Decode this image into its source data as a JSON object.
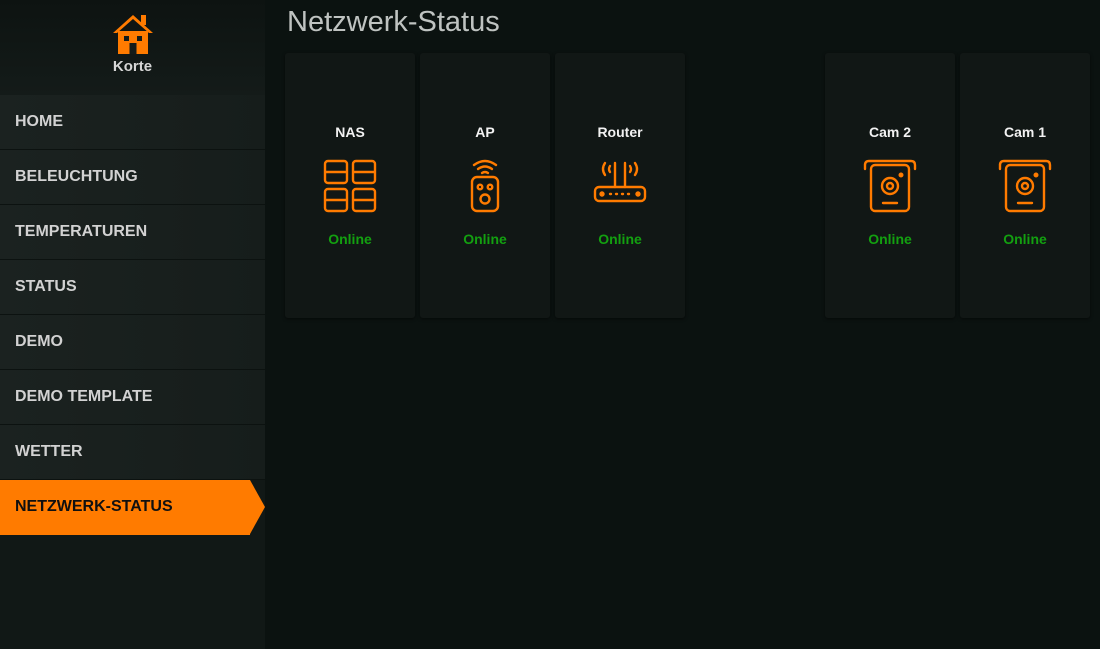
{
  "brand": {
    "name": "Korte",
    "icon": "house-icon"
  },
  "nav": {
    "items": [
      {
        "label": "HOME"
      },
      {
        "label": "BELEUCHTUNG"
      },
      {
        "label": "TEMPERATUREN"
      },
      {
        "label": "STATUS"
      },
      {
        "label": "DEMO"
      },
      {
        "label": "DEMO TEMPLATE"
      },
      {
        "label": "WETTER"
      },
      {
        "label": "NETZWERK-STATUS",
        "active": true
      }
    ]
  },
  "page": {
    "title": "Netzwerk-Status"
  },
  "devices": [
    {
      "name": "NAS",
      "status": "Online",
      "icon": "nas-icon"
    },
    {
      "name": "AP",
      "status": "Online",
      "icon": "access-point-icon"
    },
    {
      "name": "Router",
      "status": "Online",
      "icon": "router-icon"
    },
    {
      "name": "Cam 2",
      "status": "Online",
      "icon": "camera-icon"
    },
    {
      "name": "Cam 1",
      "status": "Online",
      "icon": "camera-icon"
    }
  ],
  "colors": {
    "accent": "#ff7b00",
    "online": "#13a010",
    "background": "#0b1210"
  }
}
